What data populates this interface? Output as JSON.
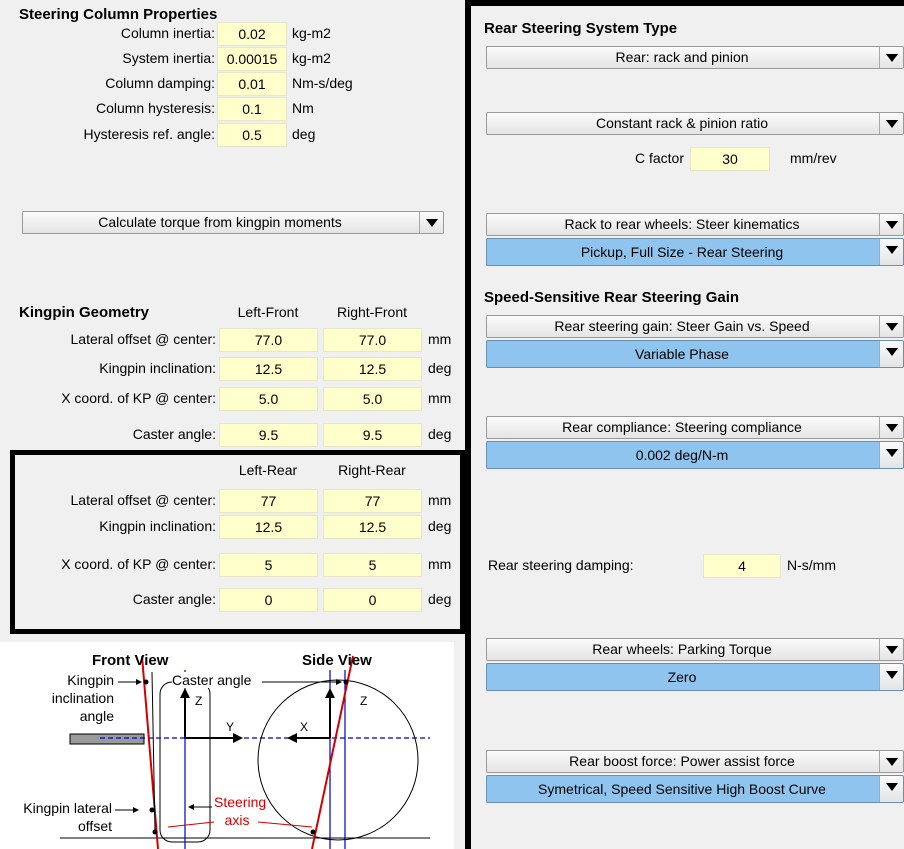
{
  "steering_column": {
    "title": "Steering Column Properties",
    "rows": [
      {
        "label": "Column inertia:",
        "value": "0.02",
        "unit": "kg-m2"
      },
      {
        "label": "System inertia:",
        "value": "0.00015",
        "unit": "kg-m2"
      },
      {
        "label": "Column damping:",
        "value": "0.01",
        "unit": "Nm-s/deg"
      },
      {
        "label": "Column hysteresis:",
        "value": "0.1",
        "unit": "Nm"
      },
      {
        "label": "Hysteresis ref. angle:",
        "value": "0.5",
        "unit": "deg"
      }
    ],
    "torque_dropdown": "Calculate torque from kingpin moments"
  },
  "kingpin_front": {
    "title": "Kingpin Geometry",
    "col_left": "Left-Front",
    "col_right": "Right-Front",
    "rows": [
      {
        "label": "Lateral offset @ center:",
        "left": "77.0",
        "right": "77.0",
        "unit": "mm"
      },
      {
        "label": "Kingpin inclination:",
        "left": "12.5",
        "right": "12.5",
        "unit": "deg"
      },
      {
        "label": "X coord. of KP @ center:",
        "left": "5.0",
        "right": "5.0",
        "unit": "mm"
      },
      {
        "label": "Caster angle:",
        "left": "9.5",
        "right": "9.5",
        "unit": "deg"
      }
    ]
  },
  "kingpin_rear": {
    "col_left": "Left-Rear",
    "col_right": "Right-Rear",
    "rows": [
      {
        "label": "Lateral offset @ center:",
        "left": "77",
        "right": "77",
        "unit": "mm"
      },
      {
        "label": "Kingpin inclination:",
        "left": "12.5",
        "right": "12.5",
        "unit": "deg"
      },
      {
        "label": "X coord. of KP @ center:",
        "left": "5",
        "right": "5",
        "unit": "mm"
      },
      {
        "label": "Caster angle:",
        "left": "0",
        "right": "0",
        "unit": "deg"
      }
    ]
  },
  "diagram": {
    "front_view": "Front View",
    "side_view": "Side View",
    "kingpin_incl_1": "Kingpin",
    "kingpin_incl_2": "inclination",
    "kingpin_incl_3": "angle",
    "caster_angle": "Caster angle",
    "kingpin_lat_1": "Kingpin lateral",
    "kingpin_lat_2": "offset",
    "steering_1": "Steering",
    "steering_2": "axis",
    "axis_z": "Z",
    "axis_y": "Y",
    "axis_x": "X",
    "axis_z2": "Z"
  },
  "rear": {
    "title": "Rear Steering System Type",
    "system_type": "Rear: rack and pinion",
    "ratio_dropdown": "Constant rack & pinion ratio",
    "c_factor_label": "C factor",
    "c_factor_value": "30",
    "c_factor_unit": "mm/rev",
    "kinematics_dropdown": "Rack to rear wheels: Steer kinematics",
    "kinematics_dataset": "Pickup, Full Size - Rear Steering",
    "gain_title": "Speed-Sensitive Rear Steering Gain",
    "gain_dropdown": "Rear steering gain: Steer Gain vs. Speed",
    "gain_dataset": "Variable Phase",
    "compliance_dropdown": "Rear compliance: Steering compliance",
    "compliance_dataset": "0.002 deg/N-m",
    "damping_label": "Rear steering damping:",
    "damping_value": "4",
    "damping_unit": "N-s/mm",
    "parking_dropdown": "Rear wheels: Parking Torque",
    "parking_dataset": "Zero",
    "boost_dropdown": "Rear boost force: Power assist force",
    "boost_dataset": "Symetrical, Speed Sensitive High Boost Curve"
  },
  "colors": {
    "field": "#ffffcc",
    "dataset": "#8fc4ef",
    "diagram_red": "#d40000",
    "diagram_blue": "#0000c0"
  }
}
